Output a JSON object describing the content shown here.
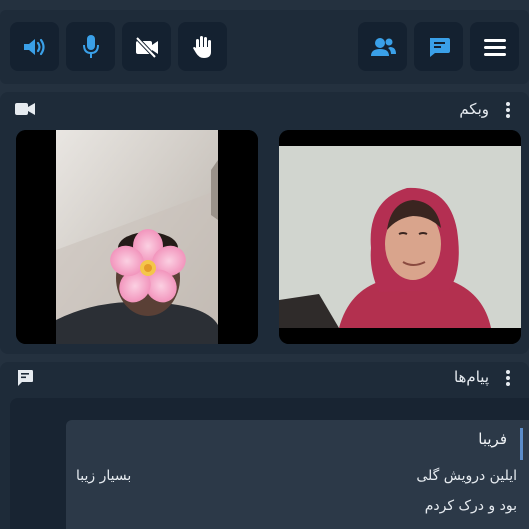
{
  "toolbar": {
    "buttons": [
      {
        "name": "volume",
        "icon": "speaker-icon",
        "color": "#3aa0e8"
      },
      {
        "name": "microphone",
        "icon": "microphone-icon",
        "color": "#3aa0e8"
      },
      {
        "name": "camera-off",
        "icon": "video-off-icon",
        "color": "#ffffff"
      },
      {
        "name": "raise-hand",
        "icon": "hand-icon",
        "color": "#ffffff"
      },
      {
        "name": "participants",
        "icon": "users-icon",
        "color": "#3aa0e8"
      },
      {
        "name": "chat",
        "icon": "chat-icon",
        "color": "#3aa0e8"
      },
      {
        "name": "menu",
        "icon": "hamburger-icon",
        "color": "#ffffff"
      }
    ]
  },
  "webcam_panel": {
    "title": "وبکم",
    "icon": "video-camera-icon"
  },
  "chat_panel": {
    "title": "پیام‌ها",
    "icon": "chat-bubble-icon",
    "message": {
      "sender": "فریبا",
      "line1_right": "ایلین درویش گلی",
      "line1_left": "بسیار زیبا",
      "line2": "بود و درک کردم"
    }
  },
  "colors": {
    "background": "#24313f",
    "panel": "#1e2b39",
    "button": "#142130",
    "accent": "#3aa0e8"
  }
}
